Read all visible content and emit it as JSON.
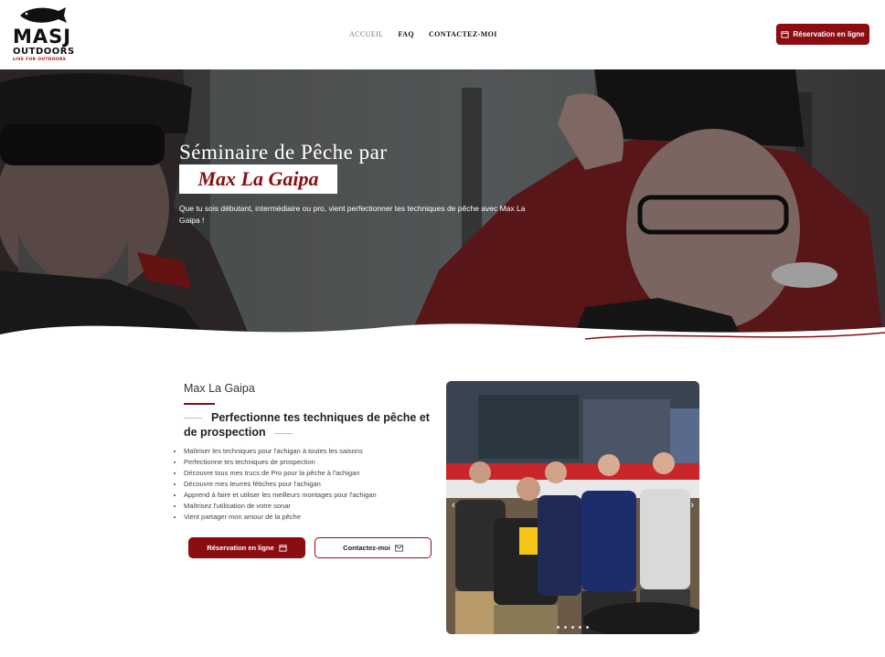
{
  "logo": {
    "main": "MASJ",
    "sub": "OUTDOORS",
    "tagline": "LIVE FOR OUTDOORS"
  },
  "nav": [
    {
      "label": "ACCUEIL"
    },
    {
      "label": "FAQ"
    },
    {
      "label": "CONTACTEZ-MOI"
    }
  ],
  "header": {
    "cta_label": "Réservation en ligne",
    "cta_icon": "calendar-icon"
  },
  "hero": {
    "title": "Séminaire de Pêche par",
    "name": "Max La Gaipa",
    "description": "Que tu sois débutant, intermédiaire ou pro, vient perfectionner tes techniques de pêche avec Max La Gaipa !"
  },
  "main": {
    "subtitle": "Max La Gaipa",
    "heading": "Perfectionne tes techniques de pêche et de prospection",
    "bullets": [
      "Maîtriser les techniques pour l'achigan à toutes les saisons",
      "Perfectionne tes techniques de prospection",
      "Découvre tous mes trucs de Pro pour la pêche à l'achigan",
      "Découvre mes leurres fétiches pour l'achigan",
      "Apprend à faire et utiliser les meilleurs montages pour l'achigan",
      "Maîtrisez l'utilisation de votre sonar",
      "Vient partager mon amour de la pêche"
    ],
    "btn_primary": "Réservation en ligne",
    "btn_secondary": "Contactez-moi"
  },
  "colors": {
    "brand": "#8b0d12"
  }
}
